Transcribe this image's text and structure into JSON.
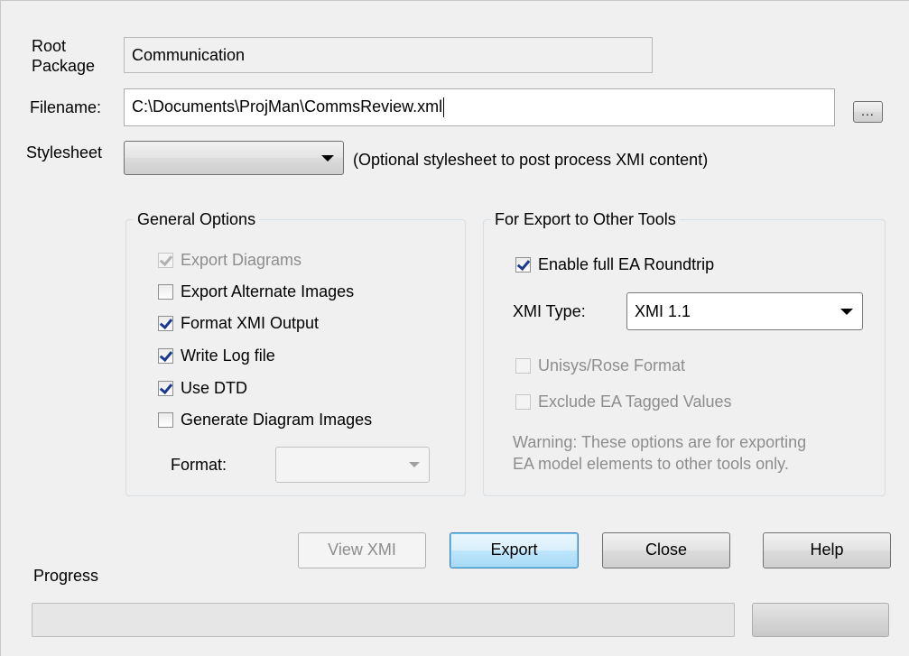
{
  "form": {
    "root_package_label_line1": "Root",
    "root_package_label_line2": "Package",
    "root_package_value": "Communication",
    "filename_label": "Filename:",
    "filename_value": "C:\\Documents\\ProjMan\\CommsReview.xml",
    "browse_label": "...",
    "stylesheet_label": "Stylesheet",
    "stylesheet_value": "",
    "stylesheet_hint": "(Optional stylesheet to post process XMI content)"
  },
  "general_options": {
    "title": "General Options",
    "items": [
      {
        "label": "Export Diagrams",
        "checked": true,
        "disabled": true
      },
      {
        "label": "Export Alternate Images",
        "checked": false,
        "disabled": false
      },
      {
        "label": "Format XMI Output",
        "checked": true,
        "disabled": false
      },
      {
        "label": "Write Log file",
        "checked": true,
        "disabled": false
      },
      {
        "label": "Use DTD",
        "checked": true,
        "disabled": false
      },
      {
        "label": "Generate Diagram Images",
        "checked": false,
        "disabled": false
      }
    ],
    "format_label": "Format:",
    "format_value": ""
  },
  "export_tools": {
    "title": "For Export to Other Tools",
    "roundtrip_label": "Enable full EA Roundtrip",
    "roundtrip_checked": true,
    "xmi_type_label": "XMI Type:",
    "xmi_type_value": "XMI 1.1",
    "unisys_label": "Unisys/Rose Format",
    "unisys_checked": false,
    "exclude_label": "Exclude EA Tagged Values",
    "exclude_checked": false,
    "warning_line1": "Warning: These options are for exporting",
    "warning_line2": "EA model elements to other tools only."
  },
  "buttons": {
    "view_xmi": "View XMI",
    "export": "Export",
    "close": "Close",
    "help": "Help"
  },
  "progress": {
    "label": "Progress",
    "value": 0
  }
}
